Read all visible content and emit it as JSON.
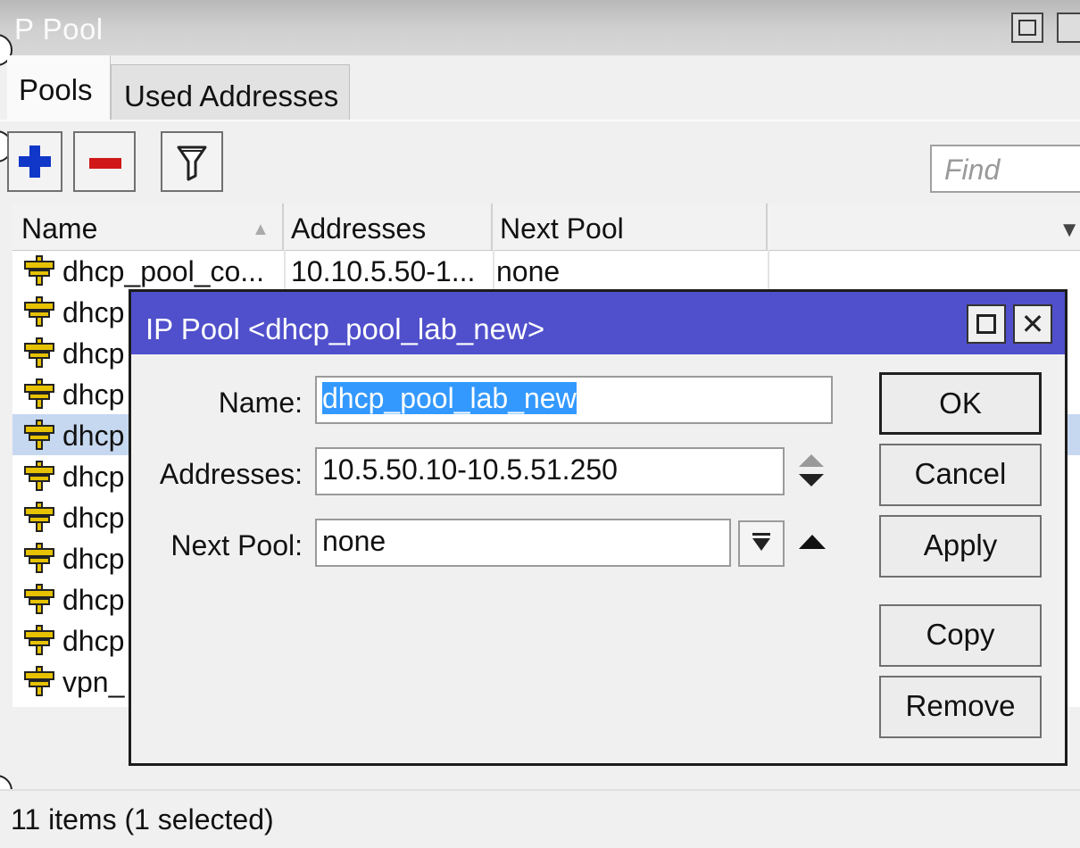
{
  "window": {
    "title": "P Pool"
  },
  "tabs": [
    {
      "label": "Pools",
      "active": true
    },
    {
      "label": "Used Addresses",
      "active": false
    }
  ],
  "toolbar": {
    "add_icon": "plus-icon",
    "remove_icon": "minus-icon",
    "filter_icon": "filter-icon",
    "find_placeholder": "Find"
  },
  "table": {
    "columns": [
      "Name",
      "Addresses",
      "Next Pool"
    ],
    "rows": [
      {
        "name": "dhcp_pool_co...",
        "addresses": "10.10.5.50-1...",
        "next": "none",
        "selected": false
      },
      {
        "name": "dhcp",
        "addresses": "",
        "next": "",
        "selected": false
      },
      {
        "name": "dhcp",
        "addresses": "",
        "next": "",
        "selected": false
      },
      {
        "name": "dhcp",
        "addresses": "",
        "next": "",
        "selected": false
      },
      {
        "name": "dhcp",
        "addresses": "",
        "next": "",
        "selected": true
      },
      {
        "name": "dhcp",
        "addresses": "",
        "next": "",
        "selected": false
      },
      {
        "name": "dhcp",
        "addresses": "",
        "next": "",
        "selected": false
      },
      {
        "name": "dhcp",
        "addresses": "",
        "next": "",
        "selected": false
      },
      {
        "name": "dhcp",
        "addresses": "",
        "next": "",
        "selected": false
      },
      {
        "name": "dhcp",
        "addresses": "",
        "next": "",
        "selected": false
      },
      {
        "name": "vpn_",
        "addresses": "",
        "next": "",
        "selected": false
      }
    ]
  },
  "status": {
    "text": "11 items (1 selected)"
  },
  "dialog": {
    "title": "IP Pool <dhcp_pool_lab_new>",
    "name_label": "Name:",
    "name_value": "dhcp_pool_lab_new",
    "addresses_label": "Addresses:",
    "addresses_value": "10.5.50.10-10.5.51.250",
    "next_pool_label": "Next Pool:",
    "next_pool_value": "none",
    "buttons": {
      "ok": "OK",
      "cancel": "Cancel",
      "apply": "Apply",
      "copy": "Copy",
      "remove": "Remove"
    }
  },
  "colors": {
    "dialog_title_bg": "#5050cc",
    "selection_bg": "#c6d8f0",
    "text_highlight": "#3399ff",
    "add_icon": "#1037c8",
    "remove_icon": "#d01818",
    "pool_icon": "#e6c200"
  }
}
